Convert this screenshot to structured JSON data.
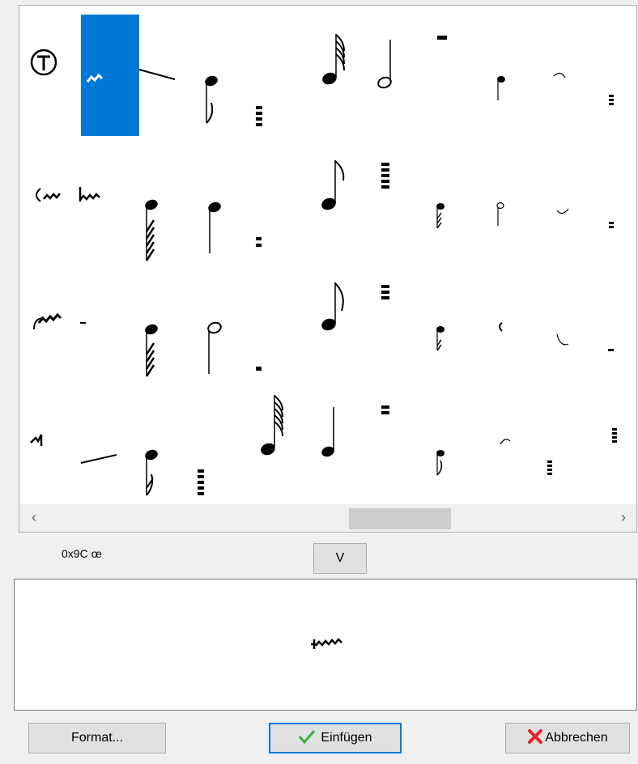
{
  "code_label": "0x9C  œ",
  "toggle_button_label": "V",
  "buttons": {
    "format": "Format...",
    "insert": "Einfügen",
    "cancel": "Abbrechen"
  },
  "scrollbar": {
    "left_arrow": "‹",
    "right_arrow": "›"
  },
  "selected_glyph_index": 1,
  "colors": {
    "accent": "#0078d7",
    "ok_green": "#3cb043",
    "cancel_red": "#e0242c"
  },
  "icons": [
    "check-icon",
    "cross-icon"
  ]
}
